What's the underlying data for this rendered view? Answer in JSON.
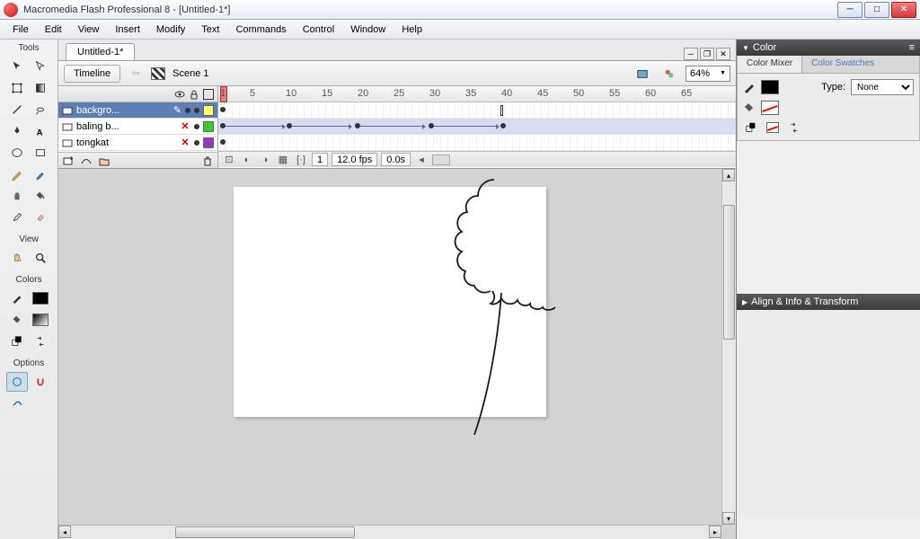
{
  "window": {
    "title": "Macromedia Flash Professional 8 - [Untitled-1*]"
  },
  "menu": [
    "File",
    "Edit",
    "View",
    "Insert",
    "Modify",
    "Text",
    "Commands",
    "Control",
    "Window",
    "Help"
  ],
  "tools": {
    "label": "Tools",
    "view_label": "View",
    "colors_label": "Colors",
    "options_label": "Options"
  },
  "document": {
    "tab_name": "Untitled-1*",
    "timeline_btn": "Timeline",
    "scene_name": "Scene 1",
    "zoom": "64%"
  },
  "timeline": {
    "ticks": [
      "1",
      "5",
      "10",
      "15",
      "20",
      "25",
      "30",
      "35",
      "40",
      "45",
      "50",
      "55",
      "60",
      "65"
    ],
    "layers": [
      {
        "name": "backgro...",
        "selected": true,
        "color": "#ffff66"
      },
      {
        "name": "baling b...",
        "selected": false,
        "color": "#33cc33"
      },
      {
        "name": "tongkat",
        "selected": false,
        "color": "#9933cc"
      }
    ],
    "status": {
      "frame": "1",
      "fps": "12.0 fps",
      "time": "0.0s"
    }
  },
  "color_panel": {
    "title": "Color",
    "tabs": [
      "Color Mixer",
      "Color Swatches"
    ],
    "type_label": "Type:",
    "type_value": "None"
  },
  "align_panel": {
    "title": "Align & Info & Transform"
  }
}
